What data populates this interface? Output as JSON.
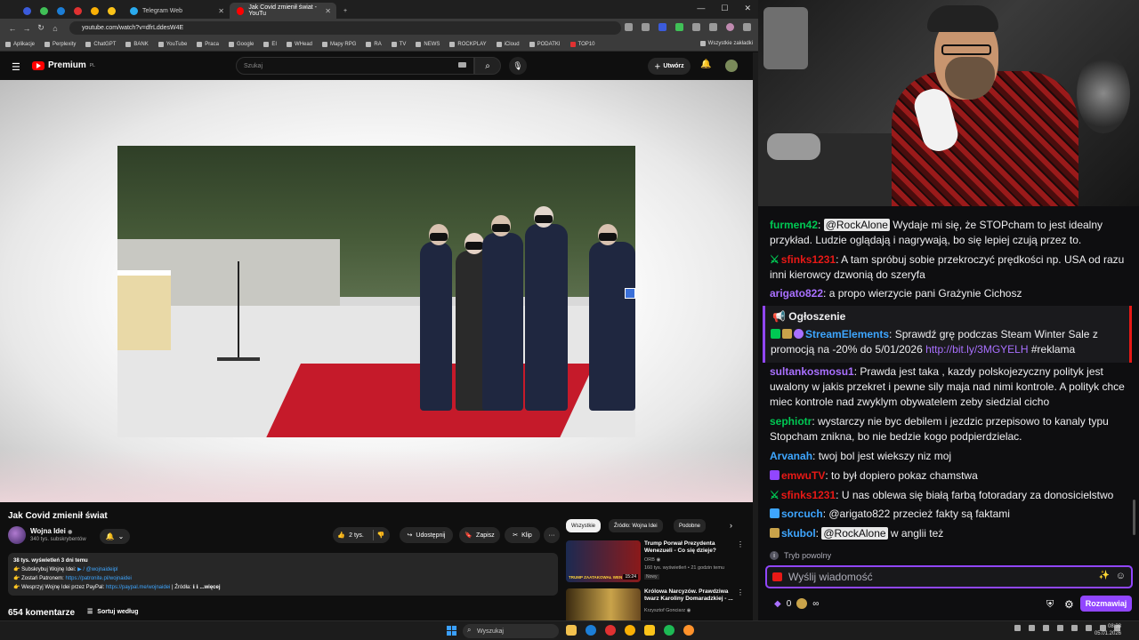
{
  "browser": {
    "tabs": [
      {
        "title": "Telegram Web",
        "active": false
      },
      {
        "title": "Jak Covid zmienił świat - YouTu",
        "active": true
      }
    ],
    "new_tab": "+",
    "url": "youtube.com/watch?v=dfrLddesW4E",
    "bookmarks": [
      "Aplikacje",
      "Perplexity",
      "ChatGPT",
      "BANK",
      "YouTube",
      "Praca",
      "Google",
      "EI",
      "WHead",
      "Mapy RPG",
      "RA",
      "TV",
      "NEWS",
      "ROCKPLAY",
      "iCloud",
      "PODATKI",
      "TOP10"
    ],
    "bookmarks_all": "Wszystkie zakładki"
  },
  "youtube": {
    "logo_text": "Premium",
    "logo_sup": "PL",
    "search_placeholder": "Szukaj",
    "create_label": "Utwórz",
    "video": {
      "title": "Jak Covid zmienił świat",
      "channel": "Wojna Idei",
      "verified": "◉",
      "subscribers": "340 tys. subskrybentów",
      "likes": "2 tys.",
      "share": "Udostępnij",
      "save": "Zapisz",
      "clip": "Klip",
      "more": "···"
    },
    "description": {
      "meta": "38 tys. wyświetleń  3 dni temu",
      "line1_a": "👉 Subskrybuj Wojnę Idei: ",
      "line1_b": "▶ / @wojnaideipl",
      "line2_a": "👉 Zostań Patronem: ",
      "line2_b": "https://patronite.pl/wojnaidei",
      "line3_a": "👉 Wesprzyj Wojnę Idei przez PayPal: ",
      "line3_b": "https://paypal.me/wojnaidei",
      "line3_c": "  |  Źródła: ℹ ℹ ",
      "more": "...więcej"
    },
    "comments_count": "654 komentarze",
    "sort_label": "Sortuj według",
    "chips": [
      "Wszystkie",
      "Źródło: Wojna Idei",
      "Podobne"
    ],
    "recommendations": [
      {
        "title": "Trump Porwał Prezydenta Wenezueli - Co się dzieje?",
        "channel": "ORB ◉",
        "meta": "160 tys. wyświetleń • 21 godzin temu",
        "badge": "Nowy",
        "duration": "15:24",
        "thumb_text": "TRUMP ZAATAKOWAŁ WEN"
      },
      {
        "title": "Królowa Narcyzów. Prawdziwa twarz Karoliny Domaradzkiej - ...",
        "channel": "Krzysztof Gonciarz ◉",
        "meta": "",
        "badge": "",
        "duration": "",
        "thumb_text": ""
      }
    ]
  },
  "chat": {
    "messages": [
      {
        "nick": "furmen42",
        "color": "#00c853",
        "mention": "@RockAlone",
        "text": " Wydaje mi się, że STOPcham to jest idealny przykład. Ludzie oglądają i nagrywają, bo się lepiej czują przez to."
      },
      {
        "nick": "sfinks1231",
        "color": "#e91916",
        "text": ": A tam spróbuj sobie przekroczyć prędkości np. USA od razu inni kierowcy dzwonią do szeryfa"
      },
      {
        "nick": "arigato822",
        "color": "#a970ff",
        "text": ": a propo wierzycie pani Grażynie Cichosz"
      },
      {
        "nick": "StreamElements",
        "color": "#3ea6ff",
        "text": ": Sprawdź grę podczas Steam Winter Sale z promocją na -20% do 5/01/2026 ",
        "link": "http://bit.ly/3MGYELH",
        "tail": " #reklama"
      },
      {
        "nick": "sultankosmosu1",
        "color": "#a970ff",
        "text": ": Prawda jest taka , kazdy polskojezyczny polityk jest uwalony w jakis przekret i pewne sily maja nad nimi kontrole. A polityk chce miec kontrole nad zwyklym obywatelem zeby siedzial cicho"
      },
      {
        "nick": "sephiotr",
        "color": "#00c853",
        "text": ": wystarczy nie byc debilem i jezdzic przepisowo to kanaly typu Stopcham znikna, bo nie bedzie kogo podpierdzielac."
      },
      {
        "nick": "Arvanah",
        "color": "#3ea6ff",
        "text": ": twoj bol jest wiekszy niz moj"
      },
      {
        "nick": "emwuTV",
        "color": "#e91916",
        "text": ": to był dopiero pokaz chamstwa"
      },
      {
        "nick": "sfinks1231",
        "color": "#e91916",
        "text": ": U nas oblewa się białą farbą fotoradary za donosicielstwo"
      },
      {
        "nick": "sorcuch",
        "color": "#3ea6ff",
        "text": ": @arigato822 przecież fakty są faktami"
      },
      {
        "nick": "skubol",
        "color": "#3ea6ff",
        "mention": "@RockAlone",
        "text": " w anglii też"
      }
    ],
    "announcement": "📢 Ogłoszenie",
    "slow_mode": "Tryb powolny",
    "input_placeholder": "Wyślij wiadomość",
    "points": "0",
    "infinity": "∞",
    "send_label": "Rozmawiaj"
  },
  "taskbar": {
    "search_label": "Wyszukaj",
    "time": "08:38",
    "date": "05.01.2026"
  },
  "colors": {
    "twitch_purple": "#9146ff",
    "youtube_red": "#ff0000",
    "link_blue": "#3ea6ff"
  }
}
